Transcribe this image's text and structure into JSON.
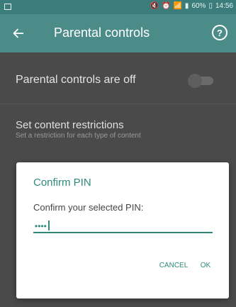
{
  "status_bar": {
    "icons": [
      "notification-icon",
      "mute-icon",
      "alarm-icon",
      "wifi-icon",
      "signal-icon"
    ],
    "battery": "60%",
    "time": "14:56"
  },
  "app_bar": {
    "title": "Parental controls"
  },
  "settings": {
    "row1_label": "Parental controls are off",
    "row2_title": "Set content restrictions",
    "row2_subtitle": "Set a restriction for each type of content"
  },
  "dialog": {
    "title": "Confirm PIN",
    "message": "Confirm your selected PIN:",
    "pin_masked": "••••",
    "cancel": "CANCEL",
    "ok": "OK"
  },
  "colors": {
    "accent": "#2e8a78",
    "app_bar": "#4c8c88",
    "status_bar": "#3a7d7a",
    "dim": "#4a4a4a"
  }
}
